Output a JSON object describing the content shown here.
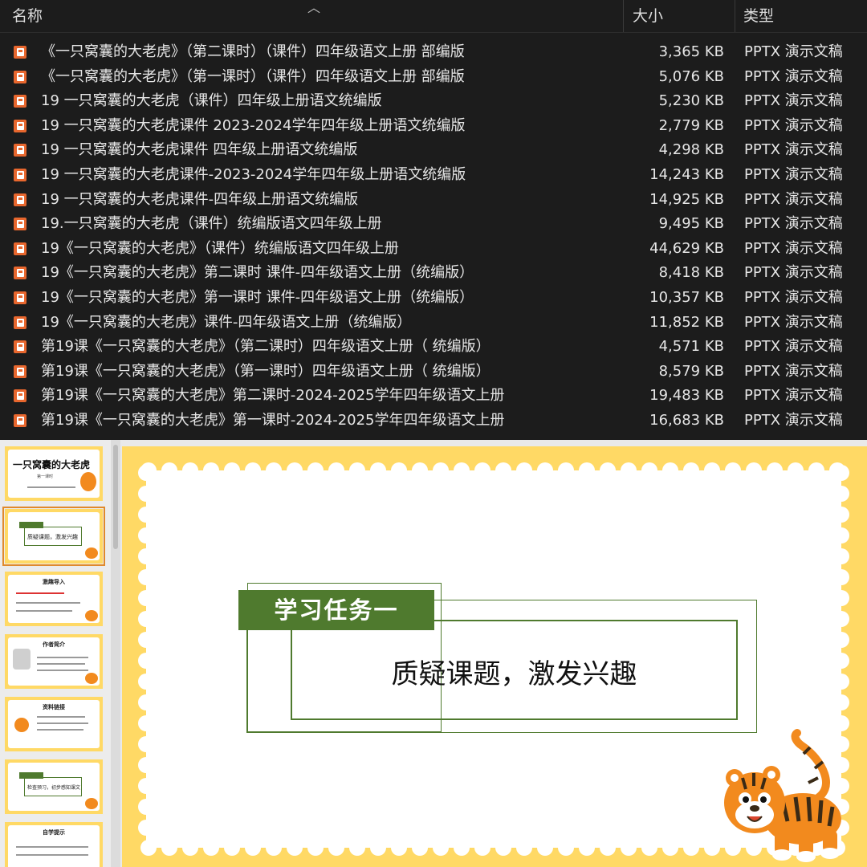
{
  "file_list": {
    "columns": {
      "name": "名称",
      "size": "大小",
      "type": "类型"
    },
    "rows": [
      {
        "name": "《一只窝囊的大老虎》（第二课时）（课件）四年级语文上册 部编版",
        "size": "3,365 KB",
        "type": "PPTX 演示文稿"
      },
      {
        "name": "《一只窝囊的大老虎》（第一课时）（课件）四年级语文上册 部编版",
        "size": "5,076 KB",
        "type": "PPTX 演示文稿"
      },
      {
        "name": "19 一只窝囊的大老虎（课件）四年级上册语文统编版",
        "size": "5,230 KB",
        "type": "PPTX 演示文稿"
      },
      {
        "name": "19 一只窝囊的大老虎课件 2023-2024学年四年级上册语文统编版",
        "size": "2,779 KB",
        "type": "PPTX 演示文稿"
      },
      {
        "name": "19 一只窝囊的大老虎课件 四年级上册语文统编版",
        "size": "4,298 KB",
        "type": "PPTX 演示文稿"
      },
      {
        "name": "19 一只窝囊的大老虎课件-2023-2024学年四年级上册语文统编版",
        "size": "14,243 KB",
        "type": "PPTX 演示文稿"
      },
      {
        "name": "19 一只窝囊的大老虎课件-四年级上册语文统编版",
        "size": "14,925 KB",
        "type": "PPTX 演示文稿"
      },
      {
        "name": "19.一只窝囊的大老虎（课件）统编版语文四年级上册",
        "size": "9,495 KB",
        "type": "PPTX 演示文稿"
      },
      {
        "name": "19《一只窝囊的大老虎》（课件）统编版语文四年级上册",
        "size": "44,629 KB",
        "type": "PPTX 演示文稿"
      },
      {
        "name": "19《一只窝囊的大老虎》第二课时 课件-四年级语文上册（统编版）",
        "size": "8,418 KB",
        "type": "PPTX 演示文稿"
      },
      {
        "name": "19《一只窝囊的大老虎》第一课时 课件-四年级语文上册（统编版）",
        "size": "10,357 KB",
        "type": "PPTX 演示文稿"
      },
      {
        "name": "19《一只窝囊的大老虎》课件-四年级语文上册（统编版）",
        "size": "11,852 KB",
        "type": "PPTX 演示文稿"
      },
      {
        "name": "第19课《一只窝囊的大老虎》（第二课时）四年级语文上册（ 统编版）",
        "size": "4,571 KB",
        "type": "PPTX 演示文稿"
      },
      {
        "name": "第19课《一只窝囊的大老虎》（第一课时）四年级语文上册（ 统编版）",
        "size": "8,579 KB",
        "type": "PPTX 演示文稿"
      },
      {
        "name": "第19课《一只窝囊的大老虎》第二课时-2024-2025学年四年级语文上册",
        "size": "19,483 KB",
        "type": "PPTX 演示文稿"
      },
      {
        "name": "第19课《一只窝囊的大老虎》第一课时-2024-2025学年四年级语文上册",
        "size": "16,683 KB",
        "type": "PPTX 演示文稿"
      }
    ]
  },
  "thumbnails": [
    {
      "title": "一只窝囊的大老虎",
      "sub": "第一课时"
    },
    {
      "title": "学习任务一",
      "label": "质疑课题，激发兴趣"
    },
    {
      "title": "激趣导入"
    },
    {
      "title": "作者简介"
    },
    {
      "title": "资料链接"
    },
    {
      "title": "学习任务二",
      "label": "检查预习，初步感知课文"
    },
    {
      "title": "自学提示"
    }
  ],
  "slide": {
    "banner": "学习任务一",
    "text": "质疑课题，激发兴趣"
  },
  "colors": {
    "frame_yellow": "#ffd965",
    "banner_green": "#4f7a2e",
    "file_icon_orange": "#e8672e",
    "list_bg": "#1c1c1c"
  }
}
